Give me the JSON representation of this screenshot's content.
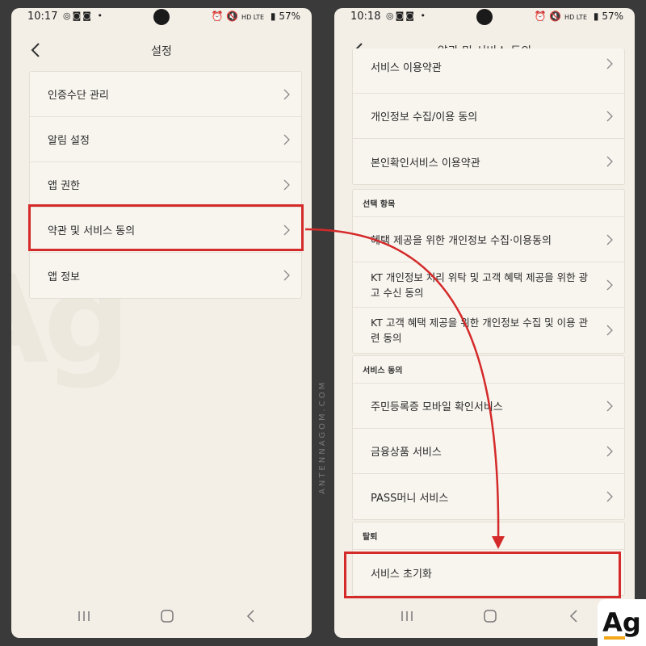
{
  "left_screen": {
    "status": {
      "time": "10:17",
      "battery": "57%",
      "network": "HD LTE"
    },
    "header": {
      "title": "설정"
    },
    "items": [
      {
        "label": "인증수단 관리"
      },
      {
        "label": "알림 설정"
      },
      {
        "label": "앱 권한"
      },
      {
        "label": "약관 및 서비스 동의"
      },
      {
        "label": "앱 정보"
      }
    ]
  },
  "right_screen": {
    "status": {
      "time": "10:18",
      "battery": "57%",
      "network": "HD LTE"
    },
    "header": {
      "title": "약관 및 서비스 동의"
    },
    "required_items": [
      {
        "label": "서비스 이용약관"
      },
      {
        "label": "개인정보 수집/이용 동의"
      },
      {
        "label": "본인확인서비스 이용약관"
      }
    ],
    "optional_section": {
      "title": "선택 항목",
      "items": [
        {
          "label": "혜택 제공을 위한 개인정보 수집·이용동의"
        },
        {
          "label": "KT 개인정보 처리 위탁 및 고객 혜택 제공을 위한 광고 수신 동의"
        },
        {
          "label": "KT 고객 혜택 제공을 위한 개인정보 수집 및 이용 관련 동의"
        }
      ]
    },
    "service_section": {
      "title": "서비스 동의",
      "items": [
        {
          "label": "주민등록증 모바일 확인서비스"
        },
        {
          "label": "금융상품 서비스"
        },
        {
          "label": "PASS머니 서비스"
        }
      ]
    },
    "withdraw_section": {
      "title": "탈퇴",
      "items": [
        {
          "label": "서비스 초기화"
        }
      ]
    }
  },
  "annotation": {
    "highlight_color": "#d42a2a",
    "site_text": "ANTENNAGOM.COM",
    "logo_text": "Ag"
  }
}
